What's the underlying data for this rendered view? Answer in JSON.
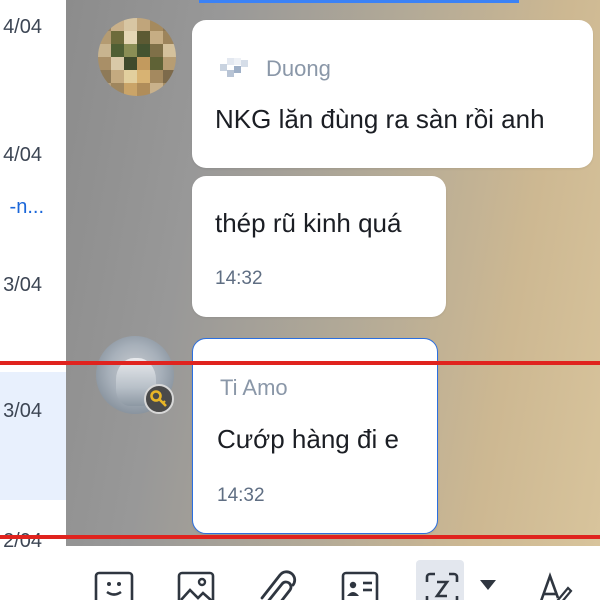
{
  "sidebar": {
    "rows": [
      {
        "date": "4/04"
      },
      {
        "date": "4/04",
        "link": "-n..."
      },
      {
        "date": "3/04"
      },
      {
        "date": "3/04"
      },
      {
        "date": "2/04"
      }
    ]
  },
  "messages": [
    {
      "sender": "Duong",
      "text": "NKG lăn đùng ra sàn rồi anh"
    },
    {
      "text": "thép rũ kinh quá",
      "time": "14:32"
    },
    {
      "sender": "Ti Amo",
      "text": "Cướp hàng đi e",
      "time": "14:32"
    }
  ],
  "colors": {
    "accent": "#2b6fe0",
    "highlight_line": "#e0231e",
    "active_row": "#e8f0fd"
  },
  "toolbar": {
    "icons": [
      "sticker-icon",
      "image-icon",
      "attachment-icon",
      "contact-card-icon",
      "screenshot-icon",
      "dropdown-arrow-icon",
      "text-format-icon"
    ]
  }
}
